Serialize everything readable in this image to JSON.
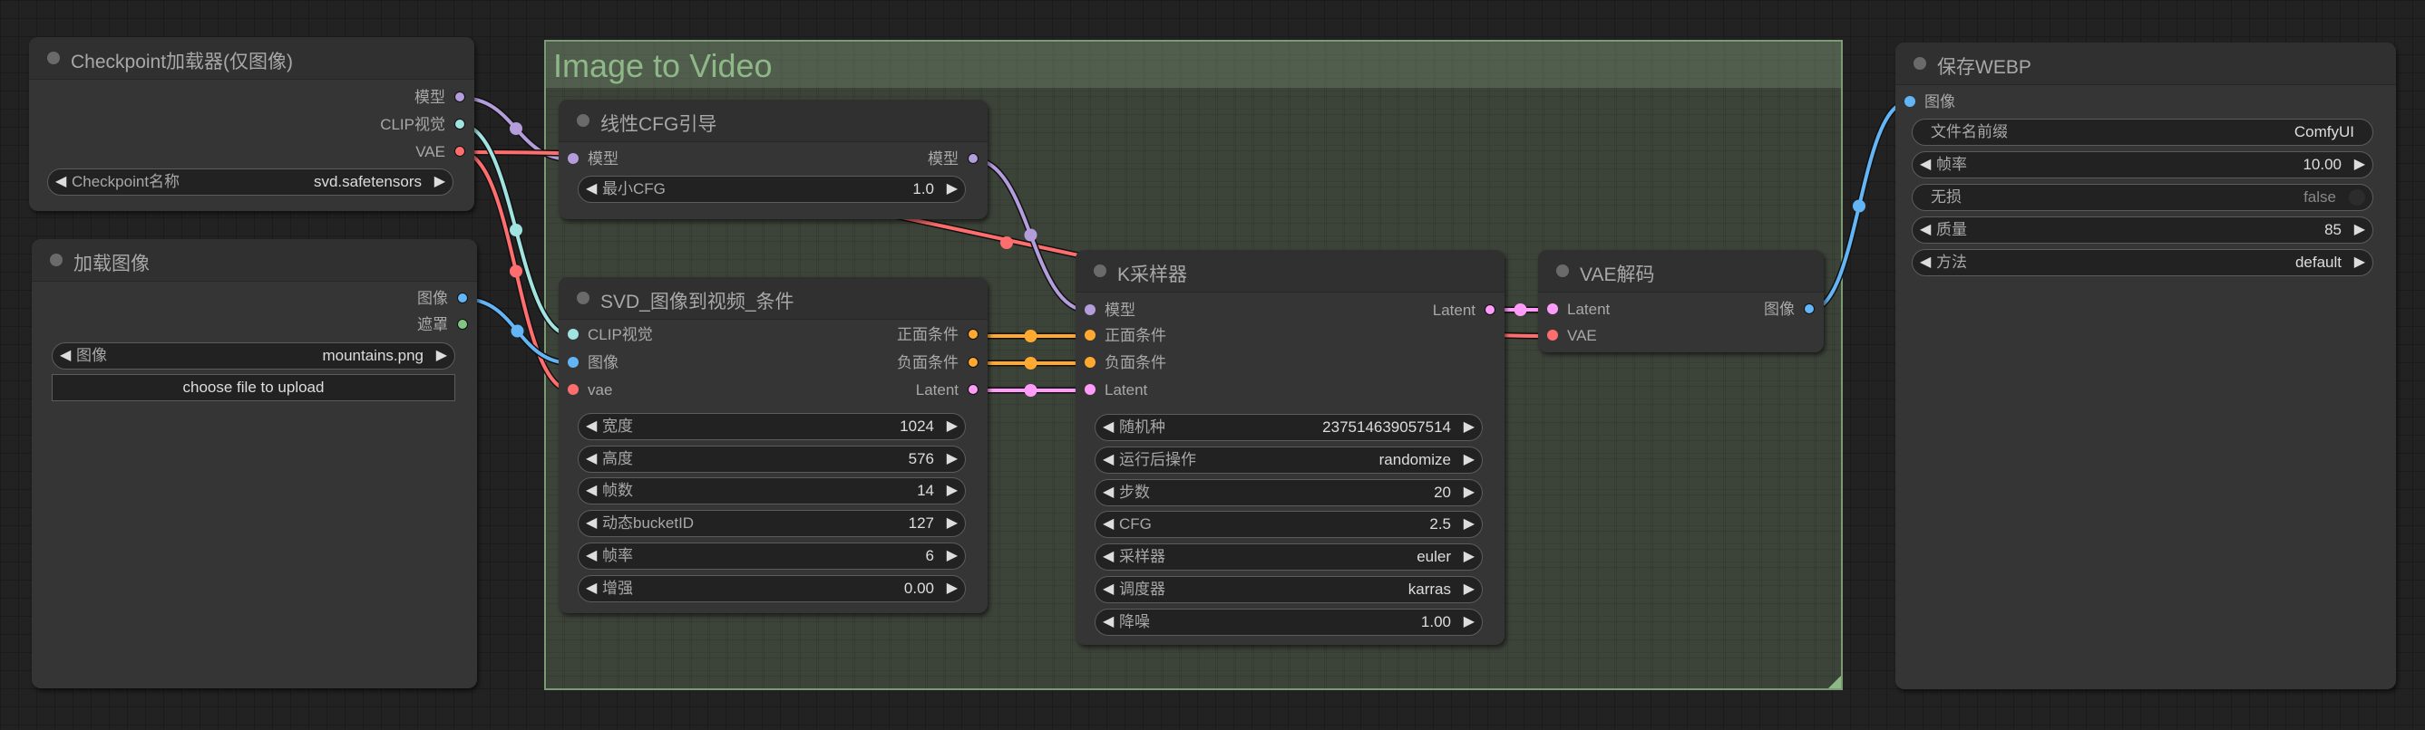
{
  "colors": {
    "model": "#b39ddb",
    "clip_vision": "#a1e3e0",
    "vae": "#ff6e6e",
    "image": "#64b5f6",
    "mask": "#81c784",
    "conditioning": "#ffa931",
    "latent": "#ff9cf9",
    "group": "#8fb888"
  },
  "group": {
    "title": "Image to Video"
  },
  "nodes": {
    "checkpoint": {
      "title": "Checkpoint加载器(仅图像)",
      "outputs": [
        "模型",
        "CLIP视觉",
        "VAE"
      ],
      "widget": {
        "label": "Checkpoint名称",
        "value": "svd.safetensors"
      }
    },
    "load_image": {
      "title": "加载图像",
      "outputs": [
        "图像",
        "遮罩"
      ],
      "widget": {
        "label": "图像",
        "value": "mountains.png"
      },
      "upload_button": "choose file to upload"
    },
    "linear_cfg": {
      "title": "线性CFG引导",
      "inputs": [
        "模型"
      ],
      "outputs": [
        "模型"
      ],
      "widget": {
        "label": "最小CFG",
        "value": "1.0"
      }
    },
    "svd_cond": {
      "title": "SVD_图像到视频_条件",
      "inputs": [
        "CLIP视觉",
        "图像",
        "vae"
      ],
      "outputs": [
        "正面条件",
        "负面条件",
        "Latent"
      ],
      "widgets": [
        {
          "label": "宽度",
          "value": "1024"
        },
        {
          "label": "高度",
          "value": "576"
        },
        {
          "label": "帧数",
          "value": "14"
        },
        {
          "label": "动态bucketID",
          "value": "127"
        },
        {
          "label": "帧率",
          "value": "6"
        },
        {
          "label": "增强",
          "value": "0.00"
        }
      ]
    },
    "ksampler": {
      "title": "K采样器",
      "inputs": [
        "模型",
        "正面条件",
        "负面条件",
        "Latent"
      ],
      "outputs": [
        "Latent"
      ],
      "widgets": [
        {
          "label": "随机种",
          "value": "237514639057514"
        },
        {
          "label": "运行后操作",
          "value": "randomize"
        },
        {
          "label": "步数",
          "value": "20"
        },
        {
          "label": "CFG",
          "value": "2.5"
        },
        {
          "label": "采样器",
          "value": "euler"
        },
        {
          "label": "调度器",
          "value": "karras"
        },
        {
          "label": "降噪",
          "value": "1.00"
        }
      ]
    },
    "vae_decode": {
      "title": "VAE解码",
      "inputs": [
        "Latent",
        "VAE"
      ],
      "outputs": [
        "图像"
      ]
    },
    "save_webp": {
      "title": "保存WEBP",
      "inputs": [
        "图像"
      ],
      "widgets": [
        {
          "label": "文件名前缀",
          "value": "ComfyUI",
          "kind": "text"
        },
        {
          "label": "帧率",
          "value": "10.00",
          "kind": "number"
        },
        {
          "label": "无损",
          "value": "false",
          "kind": "toggle"
        },
        {
          "label": "质量",
          "value": "85",
          "kind": "number"
        },
        {
          "label": "方法",
          "value": "default",
          "kind": "combo"
        }
      ]
    }
  }
}
